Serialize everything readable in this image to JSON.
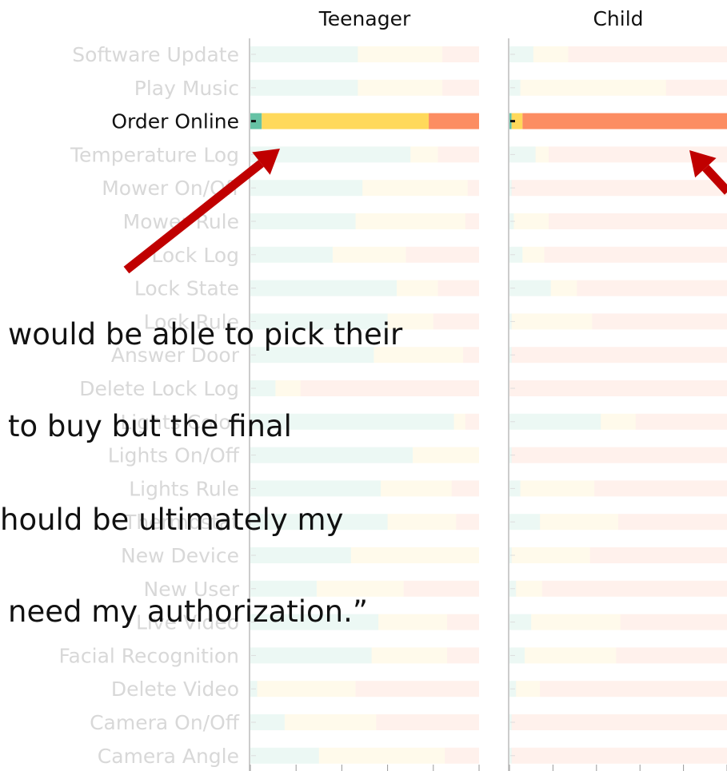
{
  "chart_data": {
    "type": "bar",
    "stacked": true,
    "orientation": "horizontal",
    "panels": [
      "Teenager",
      "Child"
    ],
    "categories": [
      "Software Update",
      "Play Music",
      "Order Online",
      "Temperature Log",
      "Mower On/Off",
      "Mower Rule",
      "Lock Log",
      "Lock State",
      "Lock Rule",
      "Answer Door",
      "Delete Lock Log",
      "Lights Color",
      "Lights On/Off",
      "Lights Rule",
      "Thermostat",
      "New Device",
      "New User",
      "Live Video",
      "Facial Recognition",
      "Delete Video",
      "Camera On/Off",
      "Camera Angle"
    ],
    "highlight_category": "Order Online",
    "series": [
      {
        "panel": "Teenager",
        "segments": [
          {
            "category": "Software Update",
            "values": [
              0.47,
              0.37,
              0.16
            ]
          },
          {
            "category": "Play Music",
            "values": [
              0.47,
              0.37,
              0.16
            ]
          },
          {
            "category": "Order Online",
            "values": [
              0.05,
              0.73,
              0.22
            ]
          },
          {
            "category": "Temperature Log",
            "values": [
              0.7,
              0.12,
              0.18
            ]
          },
          {
            "category": "Mower On/Off",
            "values": [
              0.49,
              0.46,
              0.05
            ]
          },
          {
            "category": "Mower Rule",
            "values": [
              0.46,
              0.48,
              0.06
            ]
          },
          {
            "category": "Lock Log",
            "values": [
              0.36,
              0.32,
              0.32
            ]
          },
          {
            "category": "Lock State",
            "values": [
              0.64,
              0.18,
              0.18
            ]
          },
          {
            "category": "Lock Rule",
            "values": [
              0.6,
              0.2,
              0.2
            ]
          },
          {
            "category": "Answer Door",
            "values": [
              0.54,
              0.39,
              0.07
            ]
          },
          {
            "category": "Delete Lock Log",
            "values": [
              0.11,
              0.11,
              0.78
            ]
          },
          {
            "category": "Lights Color",
            "values": [
              0.89,
              0.05,
              0.06
            ]
          },
          {
            "category": "Lights On/Off",
            "values": [
              0.71,
              0.29,
              0.0
            ]
          },
          {
            "category": "Lights Rule",
            "values": [
              0.57,
              0.31,
              0.12
            ]
          },
          {
            "category": "Thermostat",
            "values": [
              0.6,
              0.3,
              0.1
            ]
          },
          {
            "category": "New Device",
            "values": [
              0.44,
              0.56,
              0.0
            ]
          },
          {
            "category": "New User",
            "values": [
              0.29,
              0.38,
              0.33
            ]
          },
          {
            "category": "Live Video",
            "values": [
              0.56,
              0.3,
              0.14
            ]
          },
          {
            "category": "Facial Recognition",
            "values": [
              0.53,
              0.33,
              0.14
            ]
          },
          {
            "category": "Delete Video",
            "values": [
              0.03,
              0.43,
              0.54
            ]
          },
          {
            "category": "Camera On/Off",
            "values": [
              0.15,
              0.4,
              0.45
            ]
          },
          {
            "category": "Camera Angle",
            "values": [
              0.3,
              0.55,
              0.15
            ]
          }
        ]
      },
      {
        "panel": "Child",
        "segments": [
          {
            "category": "Software Update",
            "values": [
              0.11,
              0.16,
              0.73
            ]
          },
          {
            "category": "Play Music",
            "values": [
              0.05,
              0.67,
              0.28
            ]
          },
          {
            "category": "Order Online",
            "values": [
              0.01,
              0.05,
              0.94
            ]
          },
          {
            "category": "Temperature Log",
            "values": [
              0.12,
              0.06,
              0.82
            ]
          },
          {
            "category": "Mower On/Off",
            "values": [
              0.01,
              0.0,
              0.99
            ]
          },
          {
            "category": "Mower Rule",
            "values": [
              0.02,
              0.16,
              0.82
            ]
          },
          {
            "category": "Lock Log",
            "values": [
              0.06,
              0.1,
              0.84
            ]
          },
          {
            "category": "Lock State",
            "values": [
              0.19,
              0.12,
              0.69
            ]
          },
          {
            "category": "Lock Rule",
            "values": [
              0.01,
              0.37,
              0.62
            ]
          },
          {
            "category": "Answer Door",
            "values": [
              0.01,
              0.0,
              0.99
            ]
          },
          {
            "category": "Delete Lock Log",
            "values": [
              0.0,
              0.0,
              1.0
            ]
          },
          {
            "category": "Lights Color",
            "values": [
              0.42,
              0.16,
              0.42
            ]
          },
          {
            "category": "Lights On/Off",
            "values": [
              0.01,
              0.0,
              0.99
            ]
          },
          {
            "category": "Lights Rule",
            "values": [
              0.05,
              0.34,
              0.61
            ]
          },
          {
            "category": "Thermostat",
            "values": [
              0.14,
              0.36,
              0.5
            ]
          },
          {
            "category": "New Device",
            "values": [
              0.01,
              0.36,
              0.63
            ]
          },
          {
            "category": "New User",
            "values": [
              0.03,
              0.12,
              0.85
            ]
          },
          {
            "category": "Live Video",
            "values": [
              0.1,
              0.41,
              0.49
            ]
          },
          {
            "category": "Facial Recognition",
            "values": [
              0.07,
              0.42,
              0.51
            ]
          },
          {
            "category": "Delete Video",
            "values": [
              0.03,
              0.11,
              0.86
            ]
          },
          {
            "category": "Camera On/Off",
            "values": [
              0.01,
              0.0,
              0.99
            ]
          },
          {
            "category": "Camera Angle",
            "values": [
              0.01,
              0.0,
              0.99
            ]
          }
        ]
      }
    ],
    "series_colors": [
      "#66c2a5",
      "#ffd95b",
      "#fc8d62"
    ],
    "dim_opacity": 0.12,
    "xlim": [
      0,
      1
    ],
    "x_ticks": 5,
    "grid": false,
    "annotation_arrows": 2
  },
  "quote": {
    "lines": [
      "would be able to pick their",
      "to buy but the final",
      "hould be ultimately my",
      "need my authorization.”"
    ]
  },
  "colors": {
    "arrow": "#c00000",
    "label_dim": "#d8d8d8",
    "label_highlight": "#111111",
    "axis": "#cccccc"
  }
}
